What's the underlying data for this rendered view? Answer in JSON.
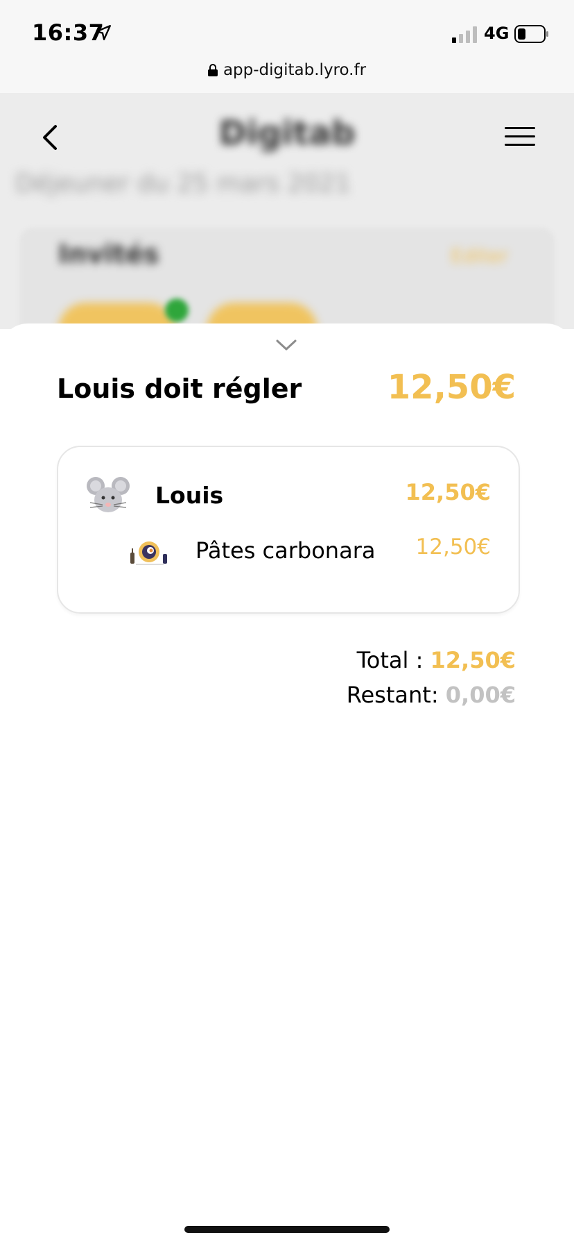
{
  "status_bar": {
    "time": "16:37",
    "network": "4G",
    "url": "app-digitab.lyro.fr"
  },
  "background_app": {
    "title": "Digitab",
    "subtitle": "Déjeuner du 25 mars 2021",
    "invites_title": "Invités",
    "edit_label": "Editer"
  },
  "sheet": {
    "title": "Louis doit régler",
    "amount": "12,50€",
    "person": {
      "name": "Louis",
      "amount": "12,50€",
      "avatar_icon": "mouse-face-icon"
    },
    "dish": {
      "name": "Pâtes carbonara",
      "amount": "12,50€",
      "icon": "dish-icon"
    },
    "total_label": "Total : ",
    "total_value": "12,50€",
    "remaining_label": "Restant: ",
    "remaining_value": "0,00€"
  },
  "colors": {
    "accent": "#f2bf52",
    "muted": "#c2c2c2"
  }
}
